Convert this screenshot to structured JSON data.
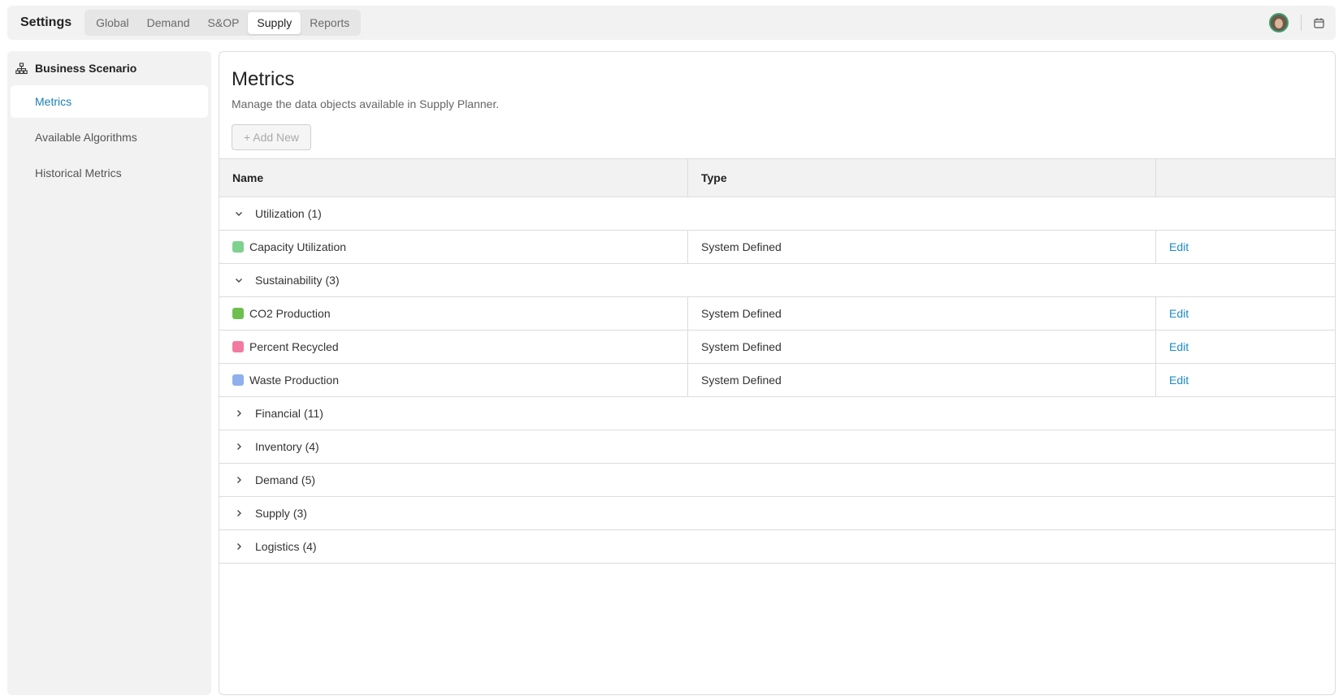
{
  "header": {
    "title": "Settings",
    "tabs": [
      {
        "label": "Global"
      },
      {
        "label": "Demand"
      },
      {
        "label": "S&OP"
      },
      {
        "label": "Supply"
      },
      {
        "label": "Reports"
      }
    ],
    "active_tab": "Supply"
  },
  "sidebar": {
    "section_title": "Business Scenario",
    "items": [
      {
        "label": "Metrics"
      },
      {
        "label": "Available Algorithms"
      },
      {
        "label": "Historical Metrics"
      }
    ],
    "active_item": "Metrics"
  },
  "main": {
    "title": "Metrics",
    "subtitle": "Manage the data objects available in Supply Planner.",
    "add_button": "+ Add New"
  },
  "table": {
    "columns": [
      "Name",
      "Type",
      ""
    ],
    "edit_label": "Edit",
    "groups": [
      {
        "name": "Utilization",
        "count": "(1)",
        "expanded": true,
        "rows": [
          {
            "name": "Capacity Utilization",
            "type": "System Defined",
            "color": "#7fd18f"
          }
        ]
      },
      {
        "name": "Sustainability",
        "count": "(3)",
        "expanded": true,
        "rows": [
          {
            "name": "CO2 Production",
            "type": "System Defined",
            "color": "#6fbf4f"
          },
          {
            "name": "Percent Recycled",
            "type": "System Defined",
            "color": "#f27aa0"
          },
          {
            "name": "Waste Production",
            "type": "System Defined",
            "color": "#8fb0ec"
          }
        ]
      },
      {
        "name": "Financial",
        "count": "(11)",
        "expanded": false,
        "rows": []
      },
      {
        "name": "Inventory",
        "count": "(4)",
        "expanded": false,
        "rows": []
      },
      {
        "name": "Demand",
        "count": "(5)",
        "expanded": false,
        "rows": []
      },
      {
        "name": "Supply",
        "count": "(3)",
        "expanded": false,
        "rows": []
      },
      {
        "name": "Logistics",
        "count": "(4)",
        "expanded": false,
        "rows": []
      }
    ]
  },
  "colors": {
    "accent": "#1a8cc8",
    "avatar_ring": "#3aa070"
  }
}
